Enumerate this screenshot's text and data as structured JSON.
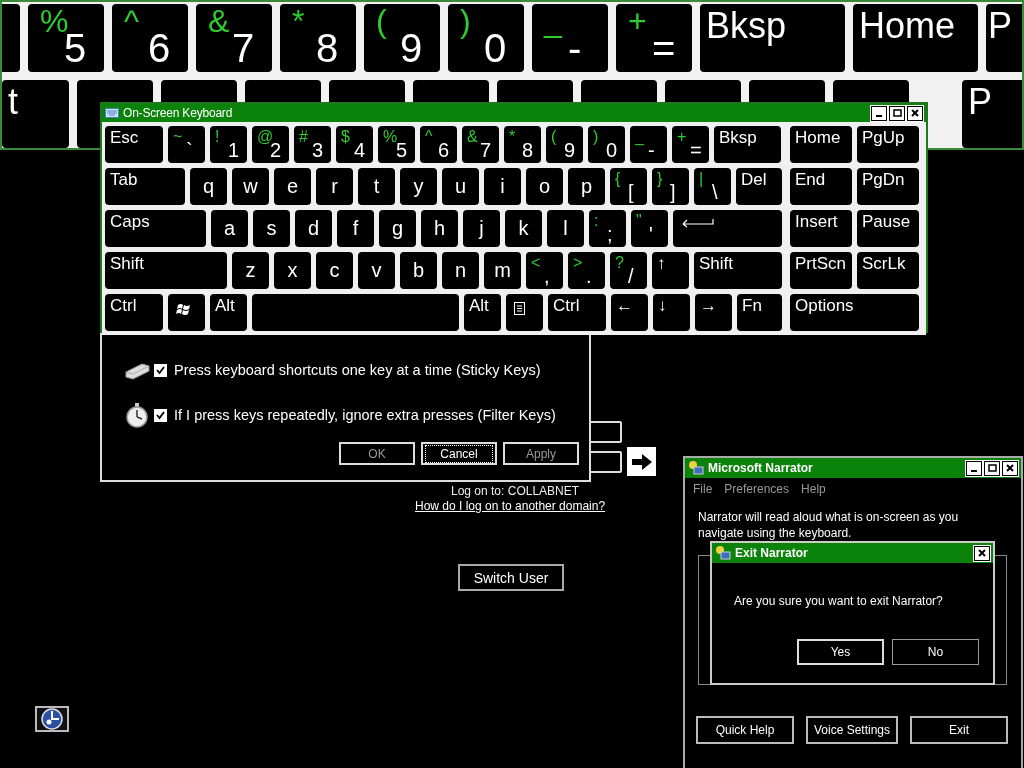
{
  "magnifier": {
    "rows": [
      [
        {
          "kind": "blank"
        },
        {
          "kind": "char",
          "shift": "%",
          "main": "5"
        },
        {
          "kind": "char",
          "shift": "^",
          "main": "6"
        },
        {
          "kind": "char",
          "shift": "&",
          "main": "7"
        },
        {
          "kind": "char",
          "shift": "*",
          "main": "8"
        },
        {
          "kind": "char",
          "shift": "(",
          "main": "9"
        },
        {
          "kind": "char",
          "shift": ")",
          "main": "0"
        },
        {
          "kind": "char",
          "shift": "_",
          "main": "-"
        },
        {
          "kind": "char",
          "shift": "+",
          "main": "="
        },
        {
          "kind": "label",
          "label": "Bksp"
        },
        {
          "kind": "label",
          "label": "Home"
        },
        {
          "kind": "label",
          "label": "P"
        }
      ],
      [
        {
          "kind": "label",
          "label": "t"
        },
        {
          "kind": "blank"
        },
        {
          "kind": "blank"
        },
        {
          "kind": "blank"
        },
        {
          "kind": "blank"
        },
        {
          "kind": "blank"
        },
        {
          "kind": "blank"
        },
        {
          "kind": "blank"
        },
        {
          "kind": "blank"
        },
        {
          "kind": "blank"
        },
        {
          "kind": "blank"
        },
        {
          "kind": "label",
          "label": "P"
        }
      ]
    ]
  },
  "on_screen_keyboard": {
    "title": "On-Screen Keyboard",
    "main_rows": [
      [
        {
          "kind": "label",
          "label": "Esc"
        },
        {
          "kind": "char",
          "shift": "~",
          "main": "`"
        },
        {
          "kind": "char",
          "shift": "!",
          "main": "1"
        },
        {
          "kind": "char",
          "shift": "@",
          "main": "2"
        },
        {
          "kind": "char",
          "shift": "#",
          "main": "3"
        },
        {
          "kind": "char",
          "shift": "$",
          "main": "4"
        },
        {
          "kind": "char",
          "shift": "%",
          "main": "5"
        },
        {
          "kind": "char",
          "shift": "^",
          "main": "6"
        },
        {
          "kind": "char",
          "shift": "&",
          "main": "7"
        },
        {
          "kind": "char",
          "shift": "*",
          "main": "8"
        },
        {
          "kind": "char",
          "shift": "(",
          "main": "9"
        },
        {
          "kind": "char",
          "shift": ")",
          "main": "0"
        },
        {
          "kind": "char",
          "shift": "_",
          "main": "-"
        },
        {
          "kind": "char",
          "shift": "+",
          "main": "="
        },
        {
          "kind": "label",
          "label": "Bksp"
        }
      ],
      [
        {
          "kind": "label",
          "label": "Tab"
        },
        {
          "kind": "char",
          "main": "q"
        },
        {
          "kind": "char",
          "main": "w"
        },
        {
          "kind": "char",
          "main": "e"
        },
        {
          "kind": "char",
          "main": "r"
        },
        {
          "kind": "char",
          "main": "t"
        },
        {
          "kind": "char",
          "main": "y"
        },
        {
          "kind": "char",
          "main": "u"
        },
        {
          "kind": "char",
          "main": "i"
        },
        {
          "kind": "char",
          "main": "o"
        },
        {
          "kind": "char",
          "main": "p"
        },
        {
          "kind": "char",
          "shift": "{",
          "main": "["
        },
        {
          "kind": "char",
          "shift": "}",
          "main": "]"
        },
        {
          "kind": "char",
          "shift": "|",
          "main": "\\"
        },
        {
          "kind": "label",
          "label": "Del"
        }
      ],
      [
        {
          "kind": "label",
          "label": "Caps"
        },
        {
          "kind": "char",
          "main": "a"
        },
        {
          "kind": "char",
          "main": "s"
        },
        {
          "kind": "char",
          "main": "d"
        },
        {
          "kind": "char",
          "main": "f"
        },
        {
          "kind": "char",
          "main": "g"
        },
        {
          "kind": "char",
          "main": "h"
        },
        {
          "kind": "char",
          "main": "j"
        },
        {
          "kind": "char",
          "main": "k"
        },
        {
          "kind": "char",
          "main": "l"
        },
        {
          "kind": "char",
          "shift": ":",
          "main": ";"
        },
        {
          "kind": "char",
          "shift": "\"",
          "main": "'"
        },
        {
          "kind": "enter"
        }
      ],
      [
        {
          "kind": "label",
          "label": "Shift"
        },
        {
          "kind": "char",
          "main": "z"
        },
        {
          "kind": "char",
          "main": "x"
        },
        {
          "kind": "char",
          "main": "c"
        },
        {
          "kind": "char",
          "main": "v"
        },
        {
          "kind": "char",
          "main": "b"
        },
        {
          "kind": "char",
          "main": "n"
        },
        {
          "kind": "char",
          "main": "m"
        },
        {
          "kind": "char",
          "shift": "<",
          "main": ","
        },
        {
          "kind": "char",
          "shift": ">",
          "main": "."
        },
        {
          "kind": "char",
          "shift": "?",
          "main": "/"
        },
        {
          "kind": "label",
          "label": "↑"
        },
        {
          "kind": "label",
          "label": "Shift"
        }
      ],
      [
        {
          "kind": "label",
          "label": "Ctrl"
        },
        {
          "kind": "windows"
        },
        {
          "kind": "label",
          "label": "Alt"
        },
        {
          "kind": "blank"
        },
        {
          "kind": "label",
          "label": "Alt"
        },
        {
          "kind": "menu"
        },
        {
          "kind": "label",
          "label": "Ctrl"
        },
        {
          "kind": "label",
          "label": "←"
        },
        {
          "kind": "label",
          "label": "↓"
        },
        {
          "kind": "label",
          "label": "→"
        },
        {
          "kind": "label",
          "label": "Fn"
        }
      ]
    ],
    "nav_rows": [
      [
        {
          "kind": "label",
          "label": "Home"
        },
        {
          "kind": "label",
          "label": "PgUp"
        }
      ],
      [
        {
          "kind": "label",
          "label": "End"
        },
        {
          "kind": "label",
          "label": "PgDn"
        }
      ],
      [
        {
          "kind": "label",
          "label": "Insert"
        },
        {
          "kind": "label",
          "label": "Pause"
        }
      ],
      [
        {
          "kind": "label",
          "label": "PrtScn"
        },
        {
          "kind": "label",
          "label": "ScrLk"
        }
      ],
      [
        {
          "kind": "label",
          "label": "Options"
        }
      ]
    ]
  },
  "accessibility_dialog": {
    "options": [
      {
        "kind": "key",
        "label": "Press keyboard shortcuts one key at a time (Sticky Keys)",
        "checked": true
      },
      {
        "kind": "stopwatch",
        "label": "If I press keys repeatedly, ignore extra presses (Filter Keys)",
        "checked": true
      }
    ],
    "buttons": [
      {
        "label": "OK",
        "disabled": true,
        "focused": false
      },
      {
        "label": "Cancel",
        "disabled": false,
        "focused": true
      },
      {
        "label": "Apply",
        "disabled": true,
        "focused": false
      }
    ]
  },
  "logon": {
    "log_on_to": "Log on to: COLLABNET",
    "help_link": "How do I log on to another domain?",
    "switch_user": "Switch User"
  },
  "narrator": {
    "title": "Microsoft Narrator",
    "menu": [
      "File",
      "Preferences",
      "Help"
    ],
    "description": "Narrator will read aloud what is on-screen as you navigate using the keyboard.",
    "buttons": [
      "Quick Help",
      "Voice Settings",
      "Exit"
    ]
  },
  "exit_dialog": {
    "title": "Exit Narrator",
    "message": "Are you sure you want to exit Narrator?",
    "buttons": [
      {
        "label": "Yes",
        "default": true
      },
      {
        "label": "No",
        "default": false
      }
    ]
  }
}
